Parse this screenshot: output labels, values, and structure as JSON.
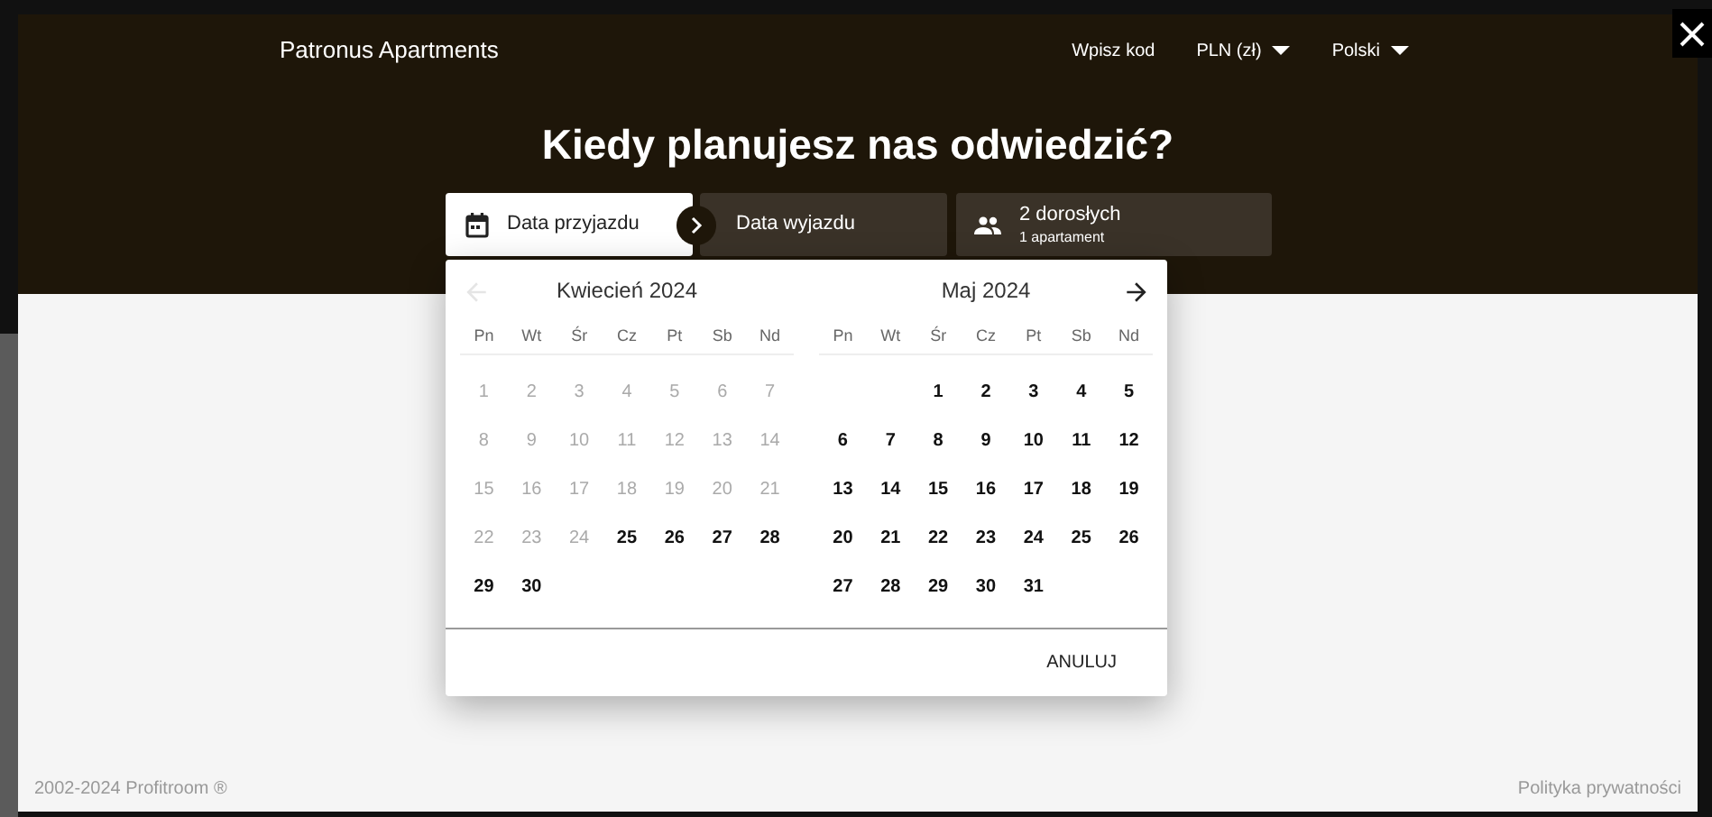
{
  "header": {
    "brand": "Patronus Apartments",
    "nav": [
      {
        "label": "Wpisz kod",
        "kind": "link"
      },
      {
        "label": "PLN (zł)",
        "kind": "dropdown"
      },
      {
        "label": "Polski",
        "kind": "dropdown"
      }
    ]
  },
  "heading": "Kiedy planujesz nas odwiedzić?",
  "search": {
    "arrival": {
      "label": "Data przyjazdu",
      "selected": true
    },
    "departure": {
      "label": "Data wyjazdu",
      "selected": false
    },
    "guests": {
      "label": "2 dorosłych",
      "sublabel": "1 apartament"
    }
  },
  "calendar": {
    "prev_disabled": true,
    "months": [
      {
        "title": "Kwiecień 2024",
        "weekdays": [
          "Pn",
          "Wt",
          "Śr",
          "Cz",
          "Pt",
          "Sb",
          "Nd"
        ],
        "weeks": [
          [
            {
              "kind": "day",
              "day": "1",
              "disabled": true
            },
            {
              "kind": "day",
              "day": "2",
              "disabled": true
            },
            {
              "kind": "day",
              "day": "3",
              "disabled": true
            },
            {
              "kind": "day",
              "day": "4",
              "disabled": true
            },
            {
              "kind": "day",
              "day": "5",
              "disabled": true
            },
            {
              "kind": "day",
              "day": "6",
              "disabled": true
            },
            {
              "kind": "day",
              "day": "7",
              "disabled": true
            }
          ],
          [
            {
              "kind": "day",
              "day": "8",
              "disabled": true
            },
            {
              "kind": "day",
              "day": "9",
              "disabled": true
            },
            {
              "kind": "day",
              "day": "10",
              "disabled": true
            },
            {
              "kind": "day",
              "day": "11",
              "disabled": true
            },
            {
              "kind": "day",
              "day": "12",
              "disabled": true
            },
            {
              "kind": "day",
              "day": "13",
              "disabled": true
            },
            {
              "kind": "day",
              "day": "14",
              "disabled": true
            }
          ],
          [
            {
              "kind": "day",
              "day": "15",
              "disabled": true
            },
            {
              "kind": "day",
              "day": "16",
              "disabled": true
            },
            {
              "kind": "day",
              "day": "17",
              "disabled": true
            },
            {
              "kind": "day",
              "day": "18",
              "disabled": true
            },
            {
              "kind": "day",
              "day": "19",
              "disabled": true
            },
            {
              "kind": "day",
              "day": "20",
              "disabled": true
            },
            {
              "kind": "day",
              "day": "21",
              "disabled": true
            }
          ],
          [
            {
              "kind": "day",
              "day": "22",
              "disabled": true
            },
            {
              "kind": "day",
              "day": "23",
              "disabled": true
            },
            {
              "kind": "day",
              "day": "24",
              "disabled": true
            },
            {
              "kind": "day",
              "day": "25",
              "disabled": false
            },
            {
              "kind": "day",
              "day": "26",
              "disabled": false
            },
            {
              "kind": "day",
              "day": "27",
              "disabled": false
            },
            {
              "kind": "day",
              "day": "28",
              "disabled": false
            }
          ],
          [
            {
              "kind": "day",
              "day": "29",
              "disabled": false
            },
            {
              "kind": "day",
              "day": "30",
              "disabled": false
            }
          ]
        ]
      },
      {
        "title": "Maj 2024",
        "weekdays": [
          "Pn",
          "Wt",
          "Śr",
          "Cz",
          "Pt",
          "Sb",
          "Nd"
        ],
        "weeks": [
          [
            {
              "kind": "empty"
            },
            {
              "kind": "empty"
            },
            {
              "kind": "day",
              "day": "1",
              "disabled": false
            },
            {
              "kind": "day",
              "day": "2",
              "disabled": false
            },
            {
              "kind": "day",
              "day": "3",
              "disabled": false
            },
            {
              "kind": "day",
              "day": "4",
              "disabled": false
            },
            {
              "kind": "day",
              "day": "5",
              "disabled": false
            }
          ],
          [
            {
              "kind": "day",
              "day": "6",
              "disabled": false
            },
            {
              "kind": "day",
              "day": "7",
              "disabled": false
            },
            {
              "kind": "day",
              "day": "8",
              "disabled": false
            },
            {
              "kind": "day",
              "day": "9",
              "disabled": false
            },
            {
              "kind": "day",
              "day": "10",
              "disabled": false
            },
            {
              "kind": "day",
              "day": "11",
              "disabled": false
            },
            {
              "kind": "day",
              "day": "12",
              "disabled": false
            }
          ],
          [
            {
              "kind": "day",
              "day": "13",
              "disabled": false
            },
            {
              "kind": "day",
              "day": "14",
              "disabled": false
            },
            {
              "kind": "day",
              "day": "15",
              "disabled": false
            },
            {
              "kind": "day",
              "day": "16",
              "disabled": false
            },
            {
              "kind": "day",
              "day": "17",
              "disabled": false
            },
            {
              "kind": "day",
              "day": "18",
              "disabled": false
            },
            {
              "kind": "day",
              "day": "19",
              "disabled": false
            }
          ],
          [
            {
              "kind": "day",
              "day": "20",
              "disabled": false
            },
            {
              "kind": "day",
              "day": "21",
              "disabled": false
            },
            {
              "kind": "day",
              "day": "22",
              "disabled": false
            },
            {
              "kind": "day",
              "day": "23",
              "disabled": false
            },
            {
              "kind": "day",
              "day": "24",
              "disabled": false
            },
            {
              "kind": "day",
              "day": "25",
              "disabled": false
            },
            {
              "kind": "day",
              "day": "26",
              "disabled": false
            }
          ],
          [
            {
              "kind": "day",
              "day": "27",
              "disabled": false
            },
            {
              "kind": "day",
              "day": "28",
              "disabled": false
            },
            {
              "kind": "day",
              "day": "29",
              "disabled": false
            },
            {
              "kind": "day",
              "day": "30",
              "disabled": false
            },
            {
              "kind": "day",
              "day": "31",
              "disabled": false
            }
          ]
        ]
      }
    ],
    "cancel": "ANULUJ"
  },
  "footer": {
    "copyright": "2002-2024 Profitroom ®",
    "privacy": "Polityka prywatności"
  }
}
